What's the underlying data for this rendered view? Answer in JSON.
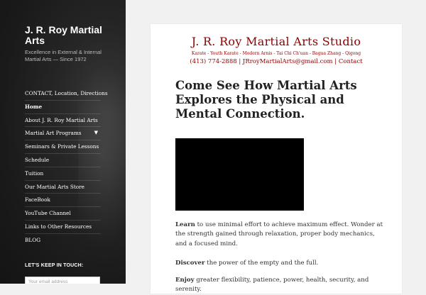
{
  "sidebar": {
    "site_title": "J. R. Roy Martial Arts",
    "description": "Excellence in External & Internal Martial Arts — Since 1972",
    "nav": [
      {
        "label": "CONTACT, Location, Directions"
      },
      {
        "label": "Home",
        "current": true
      },
      {
        "label": "About J. R. Roy Martial Arts"
      },
      {
        "label": "Martial Art Programs",
        "has_children": true
      },
      {
        "label": "Seminars & Private Lessons"
      },
      {
        "label": "Schedule"
      },
      {
        "label": "Tuition"
      },
      {
        "label": "Our Martial Arts Store"
      },
      {
        "label": "FaceBook"
      },
      {
        "label": "YouTube Channel"
      },
      {
        "label": "Links to Other Resources"
      },
      {
        "label": "BLOG"
      }
    ],
    "keep_in_touch": "LET'S KEEP IN TOUCH:",
    "email_placeholder": "Your email address"
  },
  "main": {
    "studio_title": "J. R. Roy Martial Arts Studio",
    "styles_line": "Karate  -  Youth Karate  -  Modern Arnis  -  Tai Chi Ch'uan  -  Bagua Zhang  -  Qigong",
    "contact_line": "(413) 774-2888 |  JRroyMartialArts@gmail.com |  Contact",
    "headline": "Come See How Martial Arts Explores the Physical and Mental Connection.",
    "paragraphs": [
      {
        "lead": "Learn",
        "rest": " to use minimal effort to achieve maximum effect. Wonder at the strength gained through relaxation, proper body mechanics, and a focused mind."
      },
      {
        "lead": "Discover",
        "rest": " the power of the empty and the full."
      },
      {
        "lead": "Enjoy",
        "rest": " greater flexibility, patience, power, health, security, and serenity."
      }
    ]
  },
  "colors": {
    "accent": "#8b0000",
    "sidebar_bg": "#1e1e1e",
    "page_bg": "#f1f1f1"
  }
}
